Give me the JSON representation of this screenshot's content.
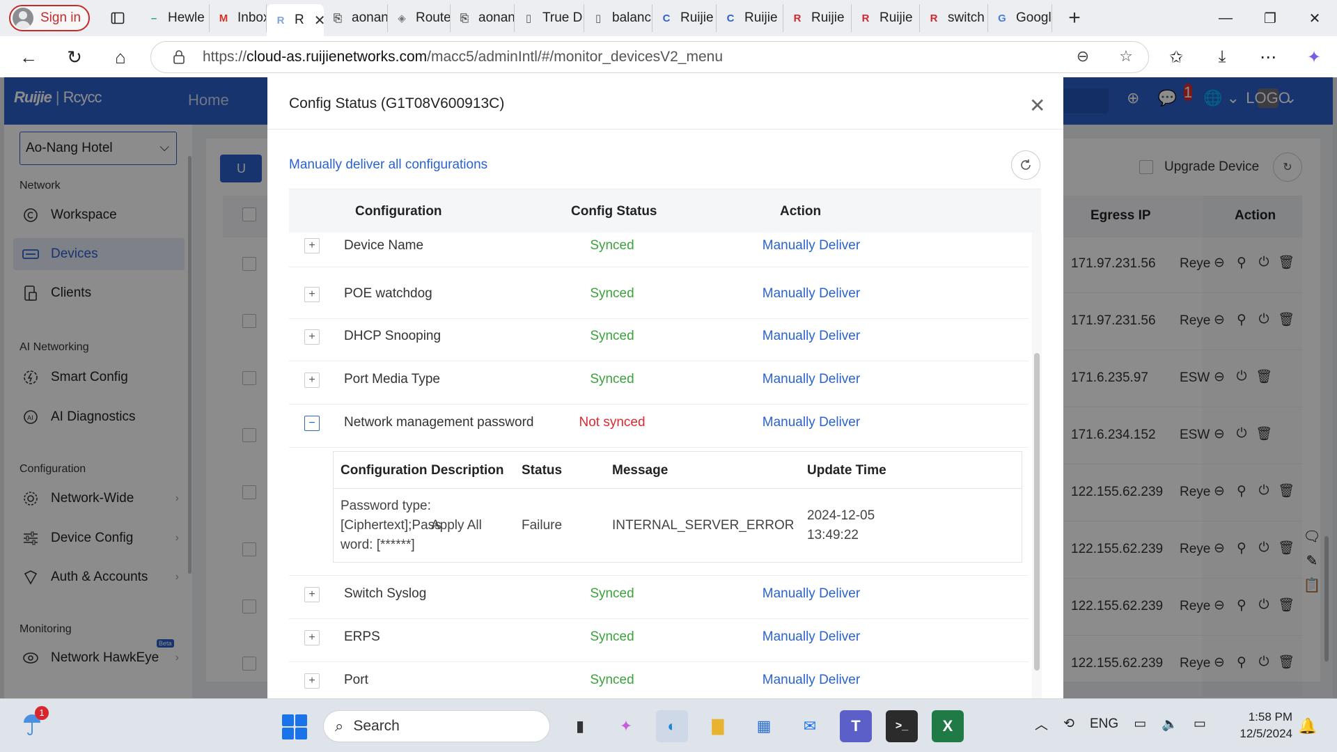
{
  "browser": {
    "sign_in": "Sign in",
    "tabs": [
      {
        "label": "Hewle",
        "fav": "–",
        "color": "#2fa37a"
      },
      {
        "label": "Inbox",
        "fav": "M",
        "color": "#d93025"
      },
      {
        "label": "R",
        "fav": "R",
        "color": "#7fa4d8",
        "active": true
      },
      {
        "label": "aonan",
        "fav": "⎘",
        "color": "#555"
      },
      {
        "label": "Route",
        "fav": "◈",
        "color": "#777"
      },
      {
        "label": "aonan",
        "fav": "⎘",
        "color": "#555"
      },
      {
        "label": "True D",
        "fav": "▯",
        "color": "#555"
      },
      {
        "label": "balanc",
        "fav": "▯",
        "color": "#555"
      },
      {
        "label": "Ruijie",
        "fav": "C",
        "color": "#2a63d0"
      },
      {
        "label": "Ruijie",
        "fav": "C",
        "color": "#2a63d0"
      },
      {
        "label": "Ruijie",
        "fav": "R",
        "color": "#d4262e"
      },
      {
        "label": "Ruijie",
        "fav": "R",
        "color": "#d4262e"
      },
      {
        "label": "switch",
        "fav": "R",
        "color": "#d4262e"
      },
      {
        "label": "Googl",
        "fav": "G",
        "color": "#4a7de0"
      }
    ],
    "url_prefix": "https://",
    "url_host": "cloud-as.ruijienetworks.com",
    "url_path": "/macc5/adminIntl/#/monitor_devicesV2_menu"
  },
  "app": {
    "logo_ruijie": "Ruijie",
    "logo_sep": "|",
    "logo_reyee": "Rcycc",
    "home": "Home",
    "notif_count": "1",
    "logo_box": "LOGO",
    "site": "Ao-Nang Hotel",
    "sidebar": {
      "network": "Network",
      "workspace": "Workspace",
      "devices": "Devices",
      "clients": "Clients",
      "ai_networking": "AI Networking",
      "smart_config": "Smart Config",
      "ai_diagnostics": "AI Diagnostics",
      "configuration": "Configuration",
      "network_wide": "Network-Wide",
      "device_config": "Device Config",
      "auth_accounts": "Auth & Accounts",
      "monitoring": "Monitoring",
      "network_hawkeye": "Network HawkEye",
      "beta": "Beta"
    },
    "upgrade_btn": "U",
    "upgrade_device": "Upgrade Device",
    "table_headers": {
      "egress_ip": "Egress IP",
      "action": "Action"
    },
    "rows": [
      {
        "ip": "171.97.231.56",
        "label": "Reye"
      },
      {
        "ip": "171.97.231.56",
        "label": "Reye"
      },
      {
        "ip": "171.6.235.97",
        "label": "ESW"
      },
      {
        "ip": "171.6.234.152",
        "label": "ESW"
      },
      {
        "ip": "122.155.62.239",
        "label": "Reye"
      },
      {
        "ip": "122.155.62.239",
        "label": "Reye"
      },
      {
        "ip": "122.155.62.239",
        "label": "Reye"
      },
      {
        "ip": "122.155.62.239",
        "label": "Reye"
      }
    ]
  },
  "modal": {
    "title": "Config Status (G1T08V600913C)",
    "deliver_all": "Manually deliver all configurations",
    "headers": {
      "configuration": "Configuration",
      "status": "Config Status",
      "action": "Action"
    },
    "rows": [
      {
        "name": "Device Name",
        "status": "Synced",
        "action": "Manually Deliver"
      },
      {
        "name": "POE watchdog",
        "status": "Synced",
        "action": "Manually Deliver"
      },
      {
        "name": "DHCP Snooping",
        "status": "Synced",
        "action": "Manually Deliver"
      },
      {
        "name": "Port Media Type",
        "status": "Synced",
        "action": "Manually Deliver"
      },
      {
        "name": "Network management password",
        "status": "Not synced",
        "action": "Manually Deliver"
      },
      {
        "name": "Switch Syslog",
        "status": "Synced",
        "action": "Manually Deliver"
      },
      {
        "name": "ERPS",
        "status": "Synced",
        "action": "Manually Deliver"
      },
      {
        "name": "Port",
        "status": "Synced",
        "action": "Manually Deliver"
      }
    ],
    "detail": {
      "headers": {
        "configuration": "Configuration",
        "description": "Description",
        "status": "Status",
        "message": "Message",
        "update_time": "Update Time"
      },
      "config_line1": "Password type:",
      "config_line2": "[Ciphertext];Pass",
      "config_line3": "word: [******]",
      "description": "Apply All",
      "status": "Failure",
      "message": "INTERNAL_SERVER_ERROR",
      "time_line1": "2024-12-05",
      "time_line2": "13:49:22"
    },
    "colors": {
      "synced": "#3aa43a",
      "not_synced": "#e0282e",
      "link": "#2a63d0"
    }
  },
  "taskbar": {
    "weather_badge": "1",
    "search": "Search",
    "lang": "ENG",
    "time": "1:58 PM",
    "date": "12/5/2024"
  }
}
